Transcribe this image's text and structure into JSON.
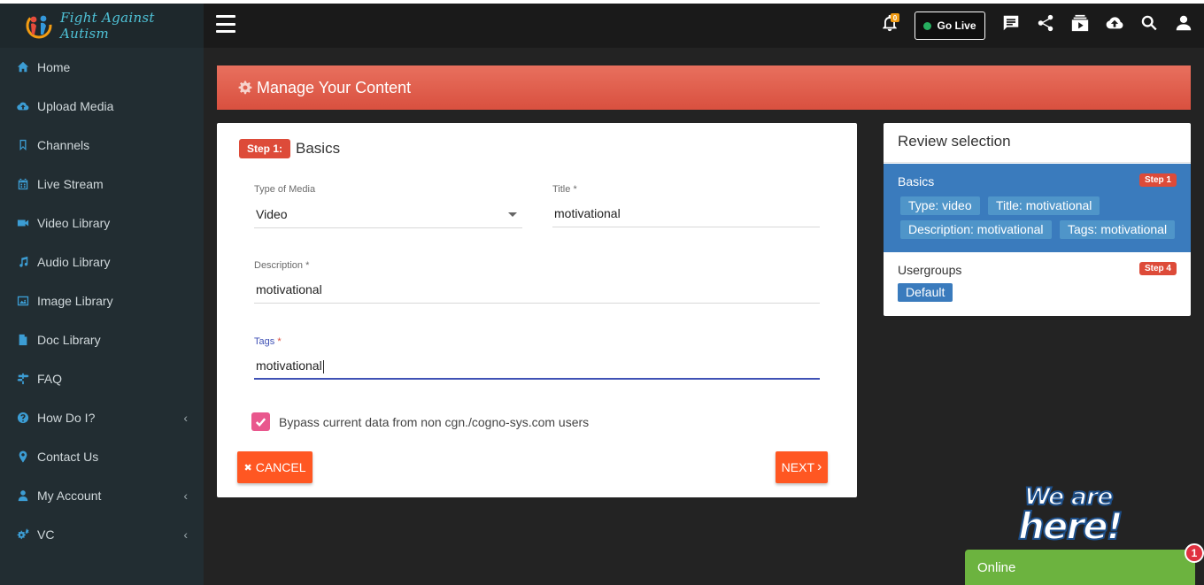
{
  "brand": {
    "name": "Fight Against Autism"
  },
  "sidebar": {
    "items": [
      {
        "label": "Home",
        "icon": "home-icon"
      },
      {
        "label": "Upload Media",
        "icon": "cloud-upload-icon"
      },
      {
        "label": "Channels",
        "icon": "bookmark-icon"
      },
      {
        "label": "Live Stream",
        "icon": "calendar-icon"
      },
      {
        "label": "Video Library",
        "icon": "video-camera-icon"
      },
      {
        "label": "Audio Library",
        "icon": "music-note-icon"
      },
      {
        "label": "Image Library",
        "icon": "image-icon"
      },
      {
        "label": "Doc Library",
        "icon": "file-icon"
      },
      {
        "label": "FAQ",
        "icon": "signpost-icon"
      },
      {
        "label": "How Do I?",
        "icon": "question-circle-icon",
        "chevron": "‹"
      },
      {
        "label": "Contact Us",
        "icon": "map-pin-icon"
      },
      {
        "label": "My Account",
        "icon": "user-icon",
        "chevron": "‹"
      },
      {
        "label": "VC",
        "icon": "cogs-icon",
        "chevron": "‹"
      }
    ]
  },
  "topbar": {
    "notification_count": "0",
    "go_live_label": "Go Live",
    "icons": [
      "bell-icon",
      "chat-icon",
      "share-icon",
      "playlist-icon",
      "cloud-upload-icon",
      "search-icon",
      "user-icon"
    ]
  },
  "banner": {
    "title": "Manage Your Content"
  },
  "form": {
    "step_badge": "Step 1:",
    "step_title": "Basics",
    "type_label": "Type of Media",
    "type_value": "Video",
    "title_label": "Title",
    "title_value": "motivational",
    "description_label": "Description",
    "description_value": "motivational",
    "tags_label": "Tags",
    "tags_value": "motivational",
    "required_mark": "*",
    "bypass_label": "Bypass current data from non cgn./cogno-sys.com users",
    "bypass_checked": true,
    "cancel_label": "CANCEL",
    "cancel_icon": "✖",
    "next_label": "NEXT",
    "next_icon": "›"
  },
  "review": {
    "title": "Review selection",
    "basics_heading": "Basics",
    "basics_step": "Step 1",
    "chips": [
      "Type: video",
      "Title: motivational",
      "Description: motivational",
      "Tags: motivational"
    ],
    "usergroups_heading": "Usergroups",
    "usergroups_step": "Step 4",
    "usergroups_chip": "Default"
  },
  "chat": {
    "line1": "We are",
    "line2": "here!",
    "status": "Online",
    "badge": "1"
  },
  "colors": {
    "sidebar_bg": "#222d32",
    "accent_blue": "#3c9dd4",
    "banner_red": "#dd4b39",
    "button_orange": "#ff5722",
    "review_blue": "#3a7bbd",
    "checkbox_pink": "#e9578d",
    "online_green": "#6cb33f"
  }
}
